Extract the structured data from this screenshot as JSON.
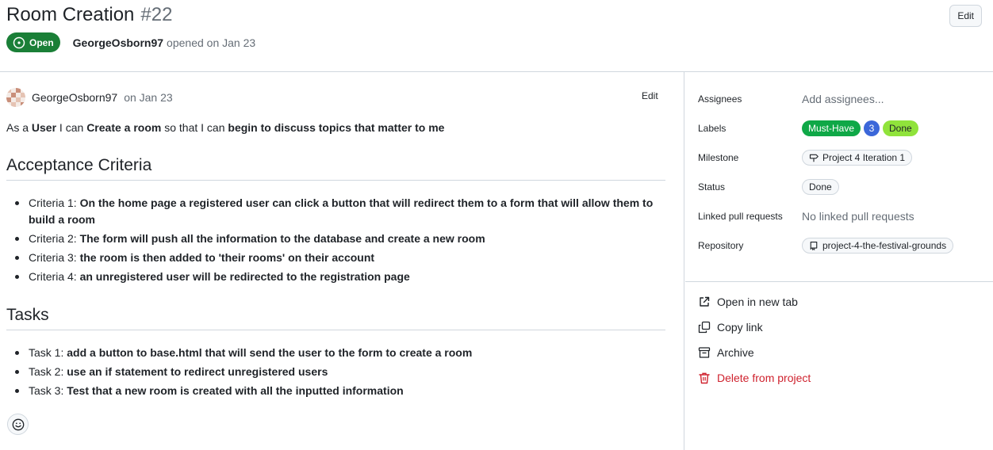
{
  "issue": {
    "title": "Room Creation",
    "number": "#22",
    "state": "Open",
    "author": "GeorgeOsborn97",
    "opened_text": "opened on Jan 23",
    "edit_label": "Edit"
  },
  "comment": {
    "author": "GeorgeOsborn97",
    "date": "on Jan 23",
    "edit_label": "Edit",
    "intro": {
      "p1": "As a ",
      "b1": "User",
      "p2": " I can ",
      "b2": "Create a room",
      "p3": " so that I can ",
      "b3": "begin to discuss topics that matter to me"
    },
    "acceptance_heading": "Acceptance Criteria",
    "criteria": [
      {
        "label": "Criteria 1:",
        "text": "On the home page a registered user can click a button that will redirect them to a form that will allow them to build a room"
      },
      {
        "label": "Criteria 2:",
        "text": "The form will push all the information to the database and create a new room"
      },
      {
        "label": "Criteria 3:",
        "text": "the room is then added to 'their rooms' on their account"
      },
      {
        "label": "Criteria 4:",
        "text": "an unregistered user will be redirected to the registration page"
      }
    ],
    "tasks_heading": "Tasks",
    "tasks": [
      {
        "label": "Task 1:",
        "text": "add a button to base.html that will send the user to the form to create a room"
      },
      {
        "label": "Task 2:",
        "text": "use an if statement to redirect unregistered users"
      },
      {
        "label": "Task 3:",
        "text": "Test that a new room is created with all the inputted information"
      }
    ],
    "reaction_icon": "smiley-icon"
  },
  "sidebar": {
    "fields": {
      "assignees": {
        "name": "Assignees",
        "value": "Add assignees..."
      },
      "labels": {
        "name": "Labels",
        "items": [
          "Must-Have",
          "3",
          "Done"
        ]
      },
      "milestone": {
        "name": "Milestone",
        "value": "Project 4 Iteration 1",
        "icon": "milestone-icon"
      },
      "status": {
        "name": "Status",
        "value": "Done"
      },
      "linked_prs": {
        "name": "Linked pull requests",
        "value": "No linked pull requests"
      },
      "repository": {
        "name": "Repository",
        "value": "project-4-the-festival-grounds",
        "icon": "repo-icon"
      }
    },
    "actions": {
      "open_new_tab": {
        "label": "Open in new tab",
        "icon": "external-link-icon"
      },
      "copy_link": {
        "label": "Copy link",
        "icon": "copy-icon"
      },
      "archive": {
        "label": "Archive",
        "icon": "archive-icon"
      },
      "delete": {
        "label": "Delete from project",
        "icon": "trash-icon"
      }
    }
  },
  "colors": {
    "open_green": "#1a7f37",
    "must_have": "#0fa847",
    "label_3": "#3b67d9",
    "done_label": "#90e33b",
    "danger": "#cf222e"
  }
}
